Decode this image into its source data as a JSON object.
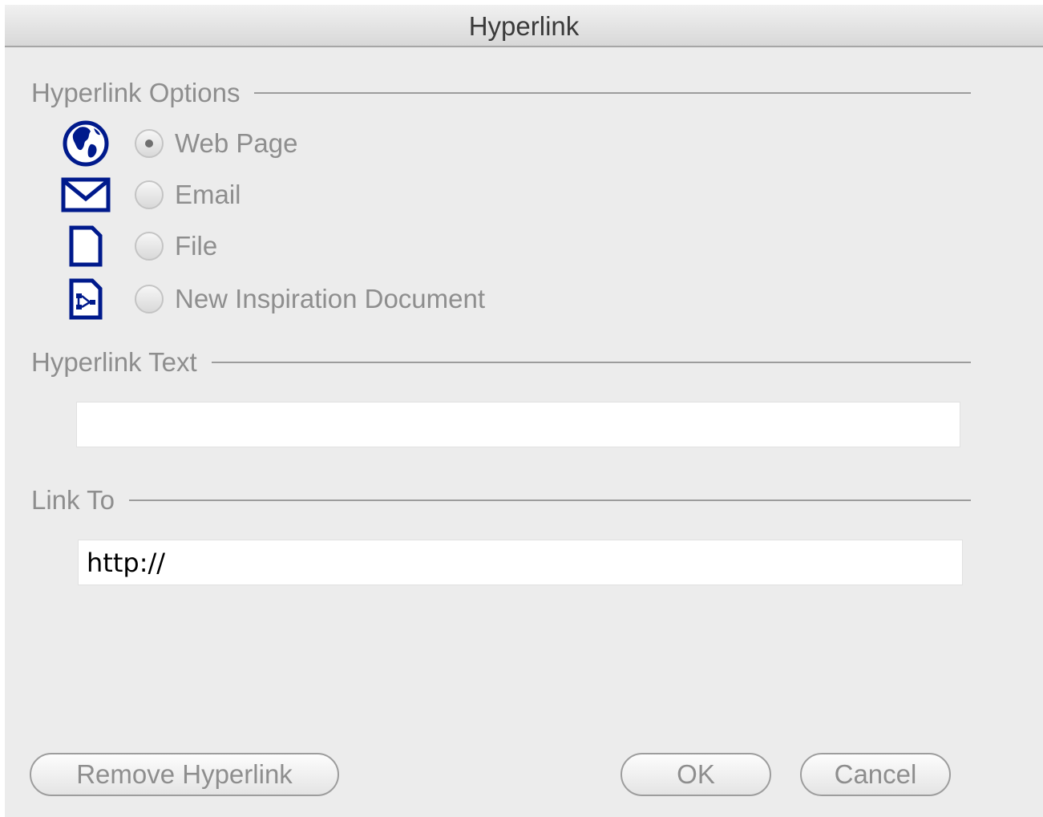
{
  "window": {
    "title": "Hyperlink"
  },
  "hyperlink_options": {
    "heading": "Hyperlink Options",
    "selected": "web_page",
    "options": [
      {
        "id": "web_page",
        "label": "Web Page",
        "icon": "globe-icon",
        "checked": true
      },
      {
        "id": "email",
        "label": "Email",
        "icon": "envelope-icon",
        "checked": false
      },
      {
        "id": "file",
        "label": "File",
        "icon": "file-icon",
        "checked": false
      },
      {
        "id": "new_doc",
        "label": "New Inspiration Document",
        "icon": "inspiration-document-icon",
        "checked": false
      }
    ]
  },
  "hyperlink_text": {
    "heading": "Hyperlink Text",
    "value": ""
  },
  "link_to": {
    "heading": "Link To",
    "value": "http://"
  },
  "buttons": {
    "remove_label": "Remove Hyperlink",
    "ok_label": "OK",
    "cancel_label": "Cancel"
  },
  "colors": {
    "icon_blue": "#001a8c",
    "dialog_bg": "#ececec",
    "disabled_text": "#8e8e8e"
  }
}
